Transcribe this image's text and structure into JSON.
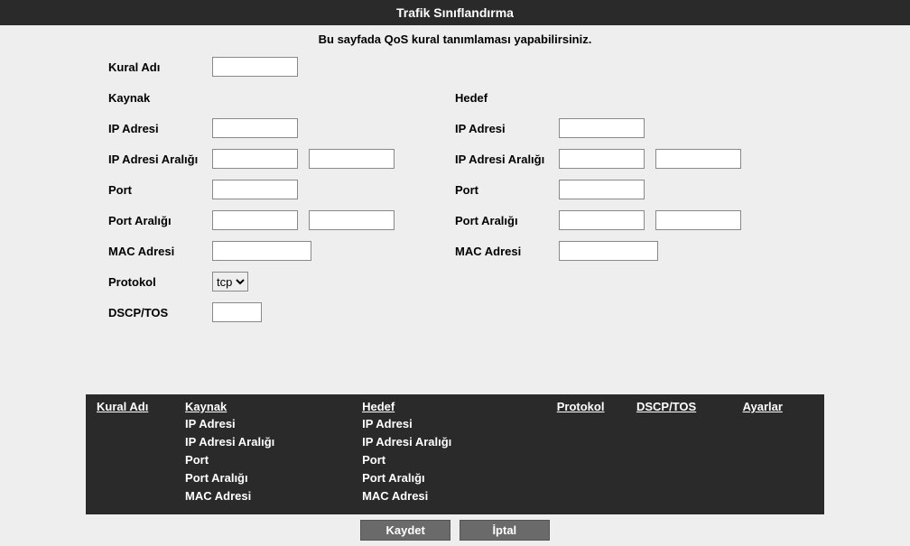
{
  "title": "Trafik Sınıflandırma",
  "subtitle": "Bu sayfada QoS kural tanımlaması yapabilirsiniz.",
  "labels": {
    "rule_name": "Kural Adı",
    "source": "Kaynak",
    "target": "Hedef",
    "ip_address": "IP Adresi",
    "ip_range": "IP Adresi Aralığı",
    "port": "Port",
    "port_range": "Port Aralığı",
    "mac_address": "MAC Adresi",
    "protocol": "Protokol",
    "dscp_tos": "DSCP/TOS"
  },
  "values": {
    "rule_name": "",
    "src_ip": "",
    "src_ip_range_a": "",
    "src_ip_range_b": "",
    "src_port": "",
    "src_port_range_a": "",
    "src_port_range_b": "",
    "src_mac": "",
    "dst_ip": "",
    "dst_ip_range_a": "",
    "dst_ip_range_b": "",
    "dst_port": "",
    "dst_port_range_a": "",
    "dst_port_range_b": "",
    "dst_mac": "",
    "protocol": "tcp",
    "dscp_tos": ""
  },
  "table": {
    "headers": {
      "rule": "Kural Adı",
      "source": "Kaynak",
      "target": "Hedef",
      "protocol": "Protokol",
      "dscp": "DSCP/TOS",
      "settings": "Ayarlar"
    },
    "source_sub": [
      "IP Adresi",
      "IP Adresi Aralığı",
      "Port",
      "Port Aralığı",
      "MAC Adresi"
    ],
    "target_sub": [
      "IP Adresi",
      "IP Adresi Aralığı",
      "Port",
      "Port Aralığı",
      "MAC Adresi"
    ]
  },
  "buttons": {
    "save": "Kaydet",
    "cancel": "İptal"
  }
}
